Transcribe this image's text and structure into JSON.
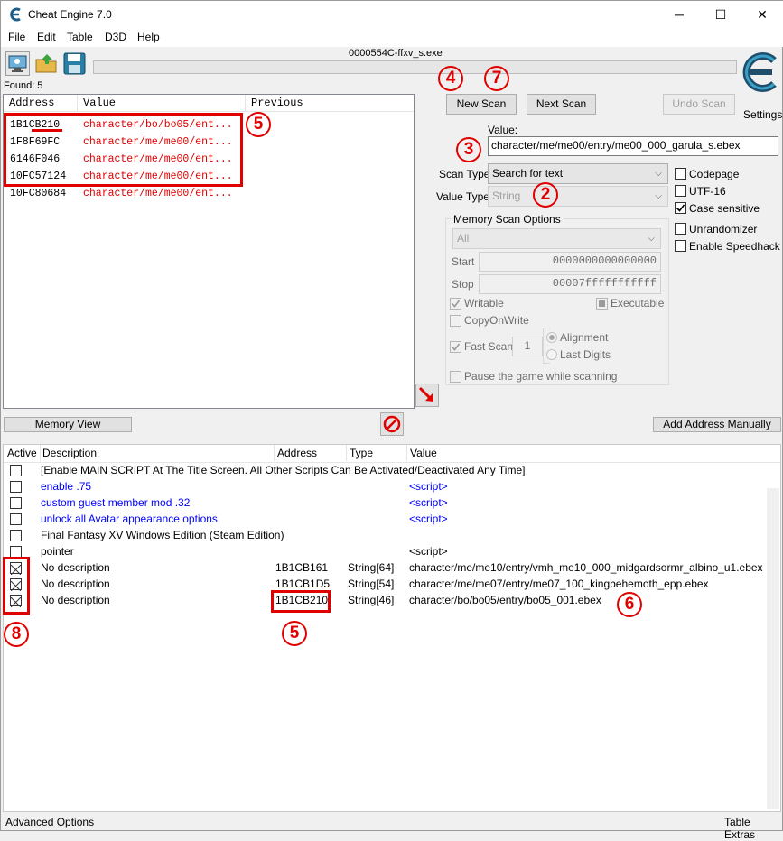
{
  "window": {
    "title": "Cheat Engine 7.0",
    "minimize": "─",
    "maximize": "☐",
    "close": "✕"
  },
  "menu": [
    "File",
    "Edit",
    "Table",
    "D3D",
    "Help"
  ],
  "process_name": "0000554C-ffxv_s.exe",
  "found_label": "Found: 5",
  "scan_results": {
    "headers": [
      "Address",
      "Value",
      "Previous"
    ],
    "rows": [
      {
        "address": "1B1CB210",
        "value": "character/bo/bo05/ent..."
      },
      {
        "address": "1F8F69FC",
        "value": "character/me/me00/ent..."
      },
      {
        "address": "6146F046",
        "value": "character/me/me00/ent..."
      },
      {
        "address": "10FC57124",
        "value": "character/me/me00/ent..."
      },
      {
        "address": "10FC80684",
        "value": "character/me/me00/ent..."
      }
    ]
  },
  "buttons": {
    "new_scan": "New Scan",
    "next_scan": "Next Scan",
    "undo_scan": "Undo Scan",
    "settings": "Settings",
    "memory_view": "Memory View",
    "add_address": "Add Address Manually"
  },
  "scan": {
    "value_label": "Value:",
    "value": "character/me/me00/entry/me00_000_garula_s.ebex",
    "scan_type_label": "Scan Type",
    "scan_type": "Search for text",
    "value_type_label": "Value Type",
    "value_type": "String",
    "options": {
      "codepage": "Codepage",
      "utf16": "UTF-16",
      "case_sensitive": "Case sensitive",
      "unrandomizer": "Unrandomizer",
      "speedhack": "Enable Speedhack"
    },
    "memory_options": {
      "title": "Memory Scan Options",
      "region": "All",
      "start_label": "Start",
      "start": "0000000000000000",
      "stop_label": "Stop",
      "stop": "00007fffffffffff",
      "writable": "Writable",
      "executable": "Executable",
      "copyonwrite": "CopyOnWrite",
      "fastscan": "Fast Scan",
      "fastscan_value": "1",
      "alignment": "Alignment",
      "lastdigits": "Last Digits",
      "pause": "Pause the game while scanning"
    }
  },
  "table": {
    "headers": [
      "Active",
      "Description",
      "Address",
      "Type",
      "Value"
    ],
    "rows": [
      {
        "desc": "[Enable MAIN SCRIPT At The Title Screen. All Other Scripts Can Be Activated/Deactivated Any Time]",
        "address": "",
        "type": "",
        "value": "",
        "blue": false,
        "checked": false
      },
      {
        "desc": "enable .75",
        "address": "",
        "type": "",
        "value": "<script>",
        "blue": true,
        "checked": false
      },
      {
        "desc": "custom guest member mod .32",
        "address": "",
        "type": "",
        "value": "<script>",
        "blue": true,
        "checked": false
      },
      {
        "desc": "unlock all Avatar appearance options",
        "address": "",
        "type": "",
        "value": "<script>",
        "blue": true,
        "checked": false
      },
      {
        "desc": "Final Fantasy XV Windows Edition (Steam Edition)",
        "address": "",
        "type": "",
        "value": "",
        "blue": false,
        "checked": false
      },
      {
        "desc": "pointer",
        "address": "",
        "type": "",
        "value": "<script>",
        "blue": false,
        "checked": false
      },
      {
        "desc": "No description",
        "address": "1B1CB161",
        "type": "String[64]",
        "value": "character/me/me10/entry/vmh_me10_000_midgardsormr_albino_u1.ebex",
        "blue": false,
        "checked": true
      },
      {
        "desc": "No description",
        "address": "1B1CB1D5",
        "type": "String[54]",
        "value": "character/me/me07/entry/me07_100_kingbehemoth_epp.ebex",
        "blue": false,
        "checked": true
      },
      {
        "desc": "No description",
        "address": "1B1CB210",
        "type": "String[46]",
        "value": "character/bo/bo05/entry/bo05_001.ebex",
        "blue": false,
        "checked": true
      }
    ]
  },
  "footer": {
    "left": "Advanced Options",
    "right": "Table Extras"
  },
  "annotations": [
    "4",
    "7",
    "5",
    "3",
    "2",
    "5",
    "6",
    "8"
  ]
}
